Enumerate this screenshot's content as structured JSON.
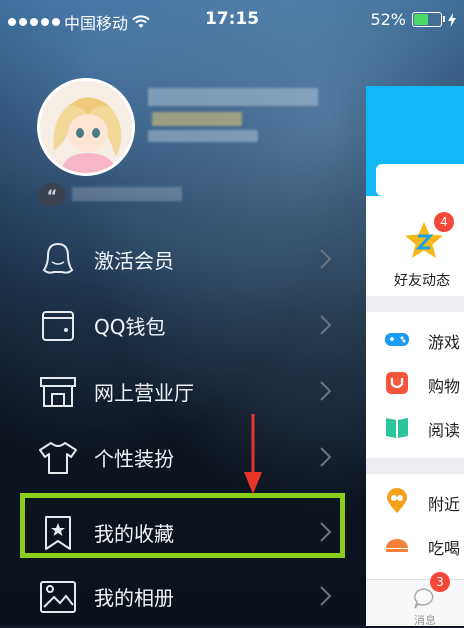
{
  "status_bar": {
    "carrier": "中国移动",
    "time": "17:15",
    "battery_percent": "52%",
    "battery_level": 0.52,
    "icons": [
      "signal-dots-icon",
      "wifi-icon",
      "battery-icon",
      "charging-bolt-icon"
    ]
  },
  "profile": {
    "avatar": "avatar-icon",
    "signature_quote_icon": "quote-icon"
  },
  "menu": {
    "items": [
      {
        "label": "激活会员",
        "icon": "penguin-icon"
      },
      {
        "label": "QQ钱包",
        "icon": "wallet-icon"
      },
      {
        "label": "网上营业厅",
        "icon": "store-icon"
      },
      {
        "label": "个性装扮",
        "icon": "tshirt-icon"
      },
      {
        "label": "我的收藏",
        "icon": "bookmark-star-icon"
      },
      {
        "label": "我的相册",
        "icon": "photo-album-icon"
      }
    ],
    "highlighted_index": 4
  },
  "panel": {
    "feature": {
      "label": "好友动态",
      "badge": "4",
      "icon": "qzone-star-icon"
    },
    "list": [
      {
        "label": "游戏",
        "icon": "gamepad-icon",
        "color": "#1b9af7"
      },
      {
        "label": "购物",
        "icon": "shopping-bag-icon",
        "color": "#f5553b"
      },
      {
        "label": "阅读",
        "icon": "book-icon",
        "color": "#2bc49b"
      }
    ],
    "list2": [
      {
        "label": "附近",
        "icon": "location-pin-icon",
        "color": "#f7a11a"
      },
      {
        "label": "吃喝",
        "icon": "food-icon",
        "color": "#f5813b"
      }
    ],
    "tabbar": {
      "message_label": "消息",
      "message_badge": "3"
    }
  },
  "colors": {
    "accent_qq_blue": "#12b7f5",
    "highlight_green": "#8ccc1a",
    "annotation_red": "#e8352a"
  }
}
